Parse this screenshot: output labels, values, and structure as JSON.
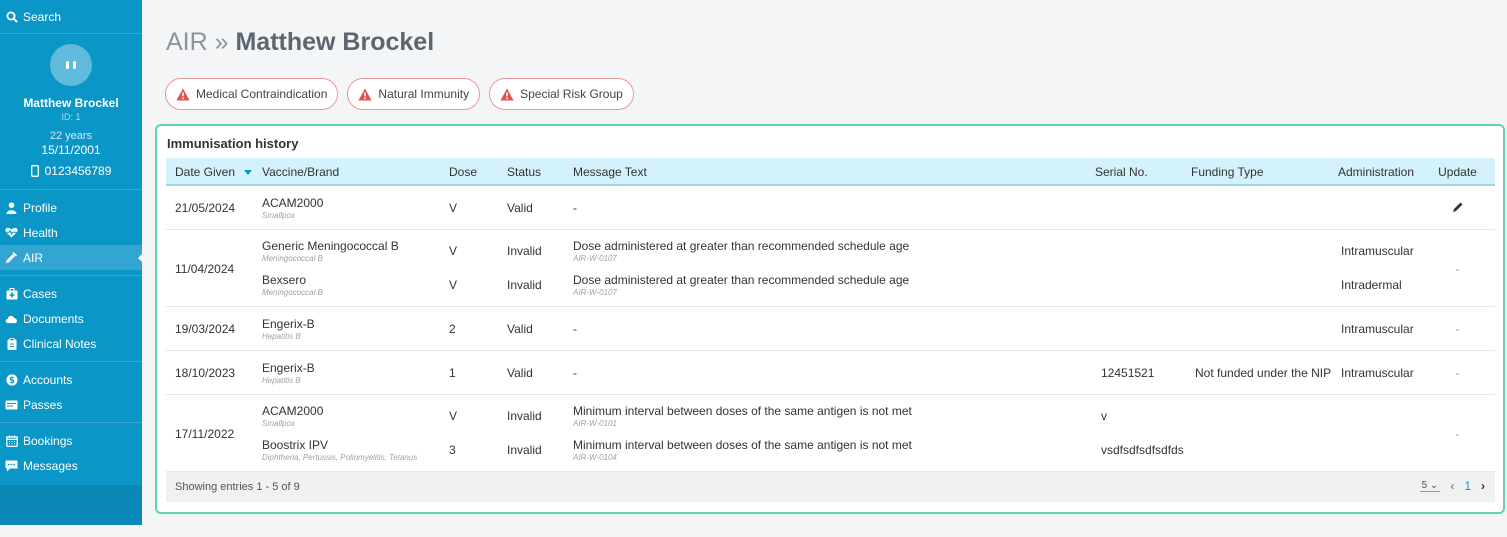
{
  "sidebar": {
    "search_label": "Search",
    "patient": {
      "name": "Matthew Brockel",
      "id": "ID: 1",
      "age": "22 years",
      "dob": "15/11/2001",
      "phone": "0123456789"
    },
    "groups": [
      [
        {
          "label": "Profile",
          "icon": "user-icon"
        },
        {
          "label": "Health",
          "icon": "heartbeat-icon"
        },
        {
          "label": "AIR",
          "icon": "syringe-icon",
          "active": true
        }
      ],
      [
        {
          "label": "Cases",
          "icon": "medkit-icon"
        },
        {
          "label": "Documents",
          "icon": "cloud-icon"
        },
        {
          "label": "Clinical Notes",
          "icon": "clipboard-icon"
        }
      ],
      [
        {
          "label": "Accounts",
          "icon": "dollar-icon"
        },
        {
          "label": "Passes",
          "icon": "card-icon"
        }
      ],
      [
        {
          "label": "Bookings",
          "icon": "calendar-icon"
        },
        {
          "label": "Messages",
          "icon": "chat-icon"
        }
      ]
    ]
  },
  "header": {
    "prefix": "AIR »",
    "name": "Matthew Brockel"
  },
  "flags": [
    "Medical Contraindication",
    "Natural Immunity",
    "Special Risk Group"
  ],
  "history": {
    "title": "Immunisation history",
    "columns": [
      "Date Given",
      "Vaccine/Brand",
      "Dose",
      "Status",
      "Message Text",
      "Serial No.",
      "Funding Type",
      "Administration",
      "Update"
    ],
    "rows": [
      {
        "date": "21/05/2024",
        "update": "edit",
        "entries": [
          {
            "vaccine": "ACAM2000",
            "antigen": "Smallpox",
            "dose": "V",
            "status": "Valid",
            "message": "-",
            "code": "",
            "serial": "",
            "funding": "",
            "admin": ""
          }
        ]
      },
      {
        "date": "11/04/2024",
        "update": "-",
        "entries": [
          {
            "vaccine": "Generic Meningococcal B",
            "antigen": "Meningococcal B",
            "dose": "V",
            "status": "Invalid",
            "message": "Dose administered at greater than recommended schedule age",
            "code": "AIR-W-0107",
            "serial": "",
            "funding": "",
            "admin": "Intramuscular"
          },
          {
            "vaccine": "Bexsero",
            "antigen": "Meningococcal B",
            "dose": "V",
            "status": "Invalid",
            "message": "Dose administered at greater than recommended schedule age",
            "code": "AIR-W-0107",
            "serial": "",
            "funding": "",
            "admin": "Intradermal"
          }
        ]
      },
      {
        "date": "19/03/2024",
        "update": "-",
        "entries": [
          {
            "vaccine": "Engerix-B",
            "antigen": "Hepatitis B",
            "dose": "2",
            "status": "Valid",
            "message": "-",
            "code": "",
            "serial": "",
            "funding": "",
            "admin": "Intramuscular"
          }
        ]
      },
      {
        "date": "18/10/2023",
        "update": "-",
        "entries": [
          {
            "vaccine": "Engerix-B",
            "antigen": "Hepatitis B",
            "dose": "1",
            "status": "Valid",
            "message": "-",
            "code": "",
            "serial": "12451521",
            "funding": "Not funded under the NIP",
            "admin": "Intramuscular"
          }
        ]
      },
      {
        "date": "17/11/2022",
        "update": "-",
        "entries": [
          {
            "vaccine": "ACAM2000",
            "antigen": "Smallpox",
            "dose": "V",
            "status": "Invalid",
            "message": "Minimum interval between doses of the same antigen is not met",
            "code": "AIR-W-0101",
            "serial": "v",
            "funding": "",
            "admin": ""
          },
          {
            "vaccine": "Boostrix IPV",
            "antigen": "Diphtheria, Pertussis, Poliomyelitis, Tetanus",
            "dose": "3",
            "status": "Invalid",
            "message": "Minimum interval between doses of the same antigen is not met",
            "code": "AIR-W-0104",
            "serial": "vsdfsdfsdfsdfds",
            "funding": "",
            "admin": ""
          }
        ]
      }
    ],
    "footer": {
      "showing": "Showing entries 1 - 5 of 9",
      "page_size": "5",
      "current_page": "1"
    }
  },
  "colors": {
    "sidebar": "#0b96c8",
    "panel_border": "#5ed6a4",
    "header_row": "#d3f2fb",
    "warning": "#e05252"
  }
}
